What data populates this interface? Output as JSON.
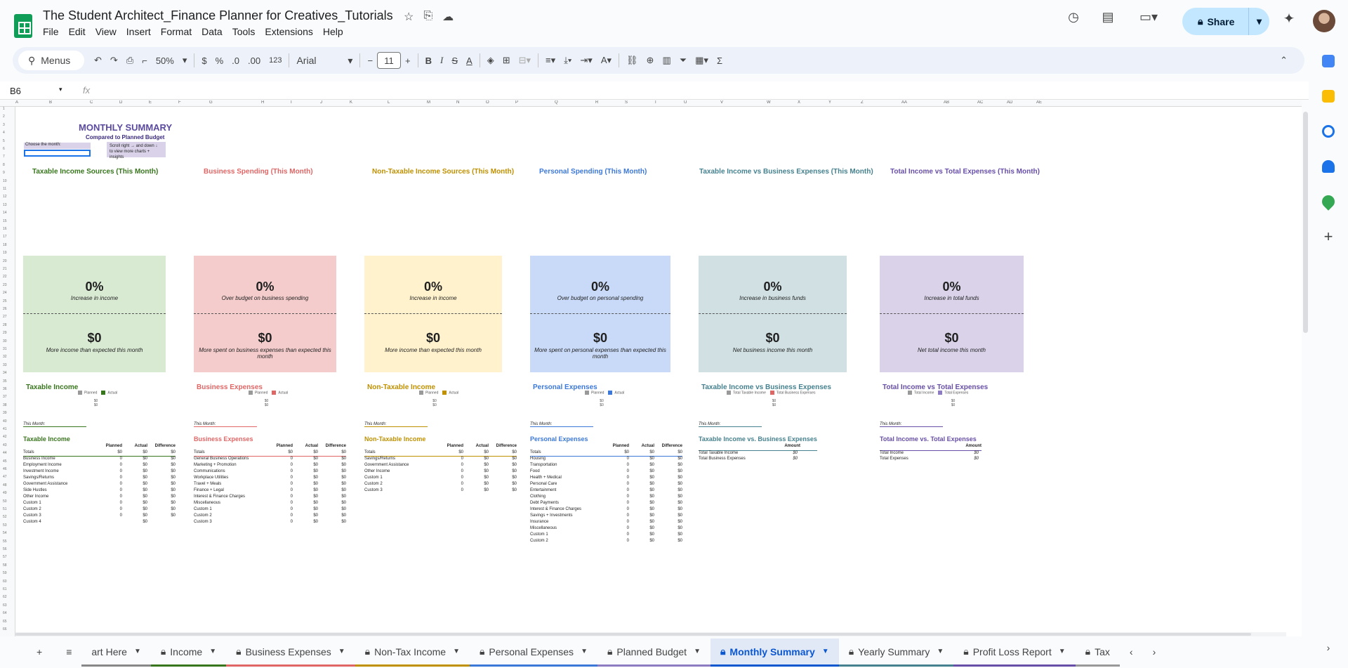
{
  "app": {
    "doc_title": "The Student Architect_Finance Planner for Creatives_Tutorials",
    "menu": [
      "File",
      "Edit",
      "View",
      "Insert",
      "Format",
      "Data",
      "Tools",
      "Extensions",
      "Help"
    ],
    "share_label": "Share"
  },
  "toolbar": {
    "menus_label": "Menus",
    "zoom": "50%",
    "currency": "$",
    "percent": "%",
    "dec_less": ".0",
    "dec_more": ".00",
    "format_123": "123",
    "font": "Arial",
    "font_size": "11",
    "bold": "B",
    "italic": "I",
    "strike": "S",
    "text_color": "A",
    "sum_icon": "Σ"
  },
  "formula_bar": {
    "cell_ref": "B6",
    "fx": "fx"
  },
  "columns": [
    "A",
    "B",
    "C",
    "D",
    "E",
    "F",
    "G",
    "H",
    "I",
    "J",
    "K",
    "L",
    "M",
    "N",
    "O",
    "P",
    "Q",
    "R",
    "S",
    "T",
    "U",
    "V",
    "W",
    "X",
    "Y",
    "Z",
    "AA",
    "AB",
    "AC",
    "AD",
    "AE"
  ],
  "sheet": {
    "title": "MONTHLY SUMMARY",
    "subtitle": "Compared to Planned Budget",
    "choose_label": "Choose the month:",
    "scroll_note_1": "Scroll right  →   and down  ↓",
    "scroll_note_2": "to view more charts + insights",
    "chart_titles": [
      "Taxable Income Sources (This Month)",
      "Business Spending (This Month)",
      "Non-Taxable Income Sources (This Month)",
      "Personal Spending (This Month)",
      "Taxable Income vs Business Expenses (This Month)",
      "Total Income vs Total Expenses (This Month)"
    ],
    "cards": [
      {
        "pct": "0%",
        "l1": "Increase in income",
        "amt": "$0",
        "l2": "More income than expected this month",
        "bg": "#d9ead3"
      },
      {
        "pct": "0%",
        "l1": "Over budget on business spending",
        "amt": "$0",
        "l2": "More spent on business expenses than expected this month",
        "bg": "#f4cccc"
      },
      {
        "pct": "0%",
        "l1": "Increase in income",
        "amt": "$0",
        "l2": "More income than expected this month",
        "bg": "#fff2cc"
      },
      {
        "pct": "0%",
        "l1": "Over budget on personal spending",
        "amt": "$0",
        "l2": "More spent on personal expenses than expected this month",
        "bg": "#c9daf8"
      },
      {
        "pct": "0%",
        "l1": "Increase in business funds",
        "amt": "$0",
        "l2": "Net business income this month",
        "bg": "#d0e0e3"
      },
      {
        "pct": "0%",
        "l1": "Increase in total funds",
        "amt": "$0",
        "l2": "Net total income this month",
        "bg": "#d9d2e9"
      }
    ],
    "sections": [
      {
        "head": "Taxable Income",
        "leg1": "Planned",
        "leg2": "Actual",
        "c2": "#38761d",
        "zero": "$0"
      },
      {
        "head": "Business Expenses",
        "leg1": "Planned",
        "leg2": "Actual",
        "c2": "#e06666",
        "zero": "$0"
      },
      {
        "head": "Non-Taxable Income",
        "leg1": "Planned",
        "leg2": "Actual",
        "c2": "#bf9000",
        "zero": "$0"
      },
      {
        "head": "Personal Expenses",
        "leg1": "Planned",
        "leg2": "Actual",
        "c2": "#3c78d8",
        "zero": "$0"
      },
      {
        "head": "Taxable Income vs Business Expenses",
        "leg1": "Total Taxable Income",
        "leg2": "Total Business Expenses",
        "c2": "#e06666",
        "zero": "$0"
      },
      {
        "head": "Total Income vs Total Expenses",
        "leg1": "Total Income",
        "leg2": "Total Expenses",
        "c2": "#8e7cc3",
        "zero": "$0"
      }
    ],
    "this_month": "This Month:",
    "cols": {
      "planned": "Planned",
      "actual": "Actual",
      "difference": "Difference",
      "amount": "Amount",
      "totals": "Totals"
    },
    "tables": [
      {
        "title": "Taxable Income",
        "rows": [
          "Business Income",
          "Employment Income",
          "Investment Income",
          "Savings/Returns",
          "Government Assistance",
          "Side Hustles",
          "Other Income",
          "Custom 1",
          "Custom 2",
          "Custom 3",
          "Custom 4"
        ]
      },
      {
        "title": "Business Expenses",
        "rows": [
          "General Business Operations",
          "Marketing + Promotion",
          "Communications",
          "Workplace Utilities",
          "Travel + Meals",
          "Finance + Legal",
          "Interest & Finance Charges",
          "Miscellaneous",
          "Custom 1",
          "Custom 2",
          "Custom 3"
        ]
      },
      {
        "title": "Non-Taxable Income",
        "rows": [
          "Savings/Returns",
          "Government Assistance",
          "Other Income",
          "Custom 1",
          "Custom 2",
          "Custom 3"
        ]
      },
      {
        "title": "Personal Expenses",
        "rows": [
          "Housing",
          "Transportation",
          "Food",
          "Health + Medical",
          "Personal Care",
          "Entertainment",
          "Clothing",
          "Debt Payments",
          "Interest & Finance Charges",
          "Savings + Investments",
          "Insurance",
          "Miscellaneous",
          "Custom 1",
          "Custom 2"
        ]
      },
      {
        "title": "Taxable Income vs. Business Expenses",
        "rows": [
          "Total Taxable Income",
          "Total Business Expenses"
        ]
      },
      {
        "title": "Total Income vs. Total Expenses",
        "rows": [
          "Total Income",
          "Total Expenses"
        ]
      }
    ],
    "zero": "0",
    "dollar_zero": "$0"
  },
  "tabs": [
    "art Here",
    "Income",
    "Business Expenses",
    "Non-Tax Income",
    "Personal Expenses",
    "Planned Budget",
    "Monthly Summary",
    "Yearly Summary",
    "Profit Loss Report",
    "Tax"
  ],
  "colors": {
    "taxable": "#38761d",
    "business": "#e06666",
    "nontax": "#bf9000",
    "personal": "#3c78d8",
    "tvb": "#45818e",
    "total": "#674ea7",
    "accent": "#0b57d0"
  }
}
